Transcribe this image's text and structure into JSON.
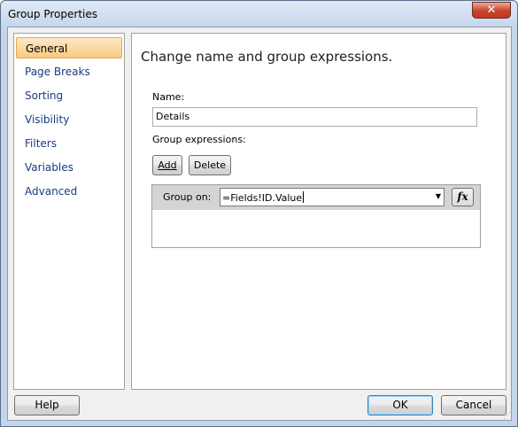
{
  "window": {
    "title": "Group Properties",
    "close_glyph": "✕"
  },
  "nav": {
    "items": [
      {
        "label": "General",
        "selected": true
      },
      {
        "label": "Page Breaks"
      },
      {
        "label": "Sorting"
      },
      {
        "label": "Visibility"
      },
      {
        "label": "Filters"
      },
      {
        "label": "Variables"
      },
      {
        "label": "Advanced"
      }
    ]
  },
  "general": {
    "heading": "Change name and group expressions.",
    "name_label": "Name:",
    "name_value": "Details",
    "group_expr_label": "Group expressions:",
    "add_button": "Add",
    "delete_button": "Delete",
    "group_on_label": "Group on:",
    "group_on_value": "=Fields!ID.Value",
    "fx_button": "fx"
  },
  "footer": {
    "help": "Help",
    "ok": "OK",
    "cancel": "Cancel"
  },
  "colors": {
    "selected_nav": "#f9c981",
    "nav_text": "#1a3b80",
    "frame": "#c4d5ea"
  }
}
